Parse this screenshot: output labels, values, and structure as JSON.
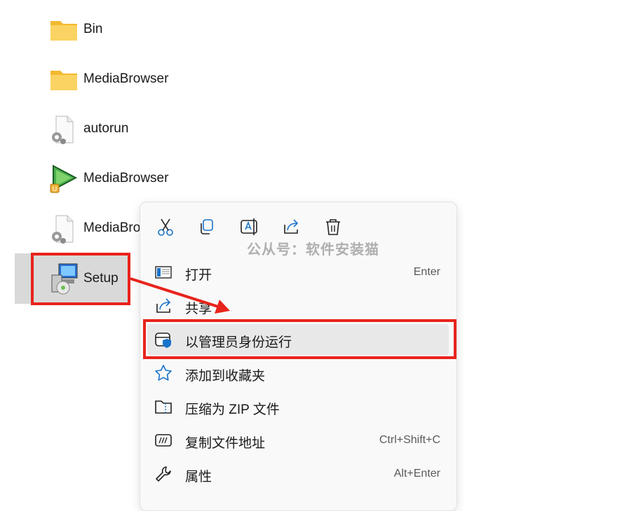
{
  "files": [
    {
      "name": "Bin",
      "icon": "folder-icon"
    },
    {
      "name": "MediaBrowser",
      "icon": "folder-icon"
    },
    {
      "name": "autorun",
      "icon": "settings-file-icon"
    },
    {
      "name": "MediaBrowser",
      "icon": "play-app-icon"
    },
    {
      "name": "MediaBro",
      "icon": "settings-file-icon"
    },
    {
      "name": "Setup",
      "icon": "installer-icon"
    }
  ],
  "quick_actions": [
    "cut-icon",
    "copy-icon",
    "rename-icon",
    "share-icon",
    "delete-icon"
  ],
  "watermark": "公从号：软件安装猫",
  "menu": [
    {
      "label": "打开",
      "shortcut": "Enter",
      "icon": "open-icon"
    },
    {
      "label": "共享",
      "shortcut": "",
      "icon": "share-icon"
    },
    {
      "label": "以管理员身份运行",
      "shortcut": "",
      "icon": "shield-icon"
    },
    {
      "label": "添加到收藏夹",
      "shortcut": "",
      "icon": "star-icon"
    },
    {
      "label": "压缩为 ZIP 文件",
      "shortcut": "",
      "icon": "zip-folder-icon"
    },
    {
      "label": "复制文件地址",
      "shortcut": "Ctrl+Shift+C",
      "icon": "copy-path-icon"
    },
    {
      "label": "属性",
      "shortcut": "Alt+Enter",
      "icon": "wrench-icon"
    }
  ],
  "colors": {
    "annotation_red": "#e8231c",
    "folder_yellow": "#f7c948",
    "accent_blue": "#1a73c9"
  }
}
